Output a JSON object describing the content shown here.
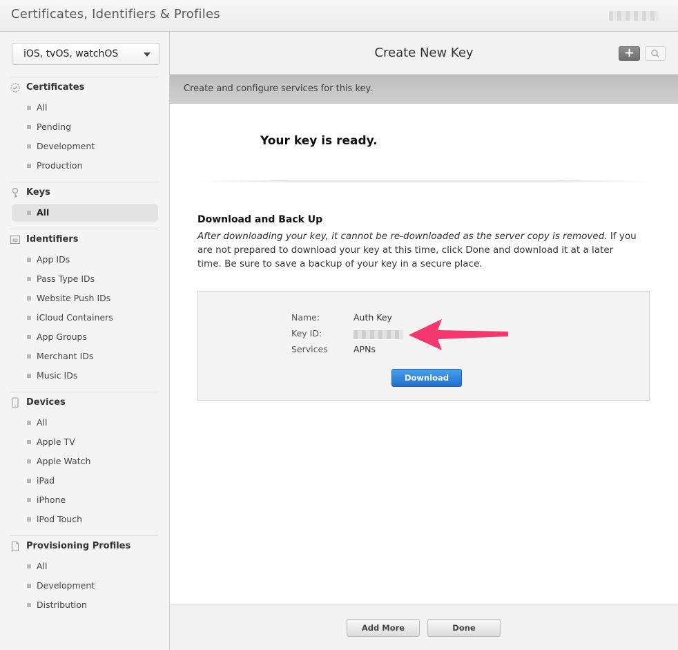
{
  "app": {
    "title": "Certificates, Identifiers & Profiles"
  },
  "platform_select": {
    "value": "iOS, tvOS, watchOS"
  },
  "sidebar": {
    "sections": [
      {
        "title": "Certificates",
        "icon": "certificate-icon",
        "items": [
          "All",
          "Pending",
          "Development",
          "Production"
        ]
      },
      {
        "title": "Keys",
        "icon": "key-icon",
        "items": [
          "All"
        ],
        "selected": "All"
      },
      {
        "title": "Identifiers",
        "icon": "id-icon",
        "items": [
          "App IDs",
          "Pass Type IDs",
          "Website Push IDs",
          "iCloud Containers",
          "App Groups",
          "Merchant IDs",
          "Music IDs"
        ]
      },
      {
        "title": "Devices",
        "icon": "device-icon",
        "items": [
          "All",
          "Apple TV",
          "Apple Watch",
          "iPad",
          "iPhone",
          "iPod Touch"
        ]
      },
      {
        "title": "Provisioning Profiles",
        "icon": "document-icon",
        "items": [
          "All",
          "Development",
          "Distribution"
        ]
      }
    ]
  },
  "main": {
    "title": "Create New Key",
    "subtitle": "Create and configure services for this key.",
    "ready_message": "Your key is ready.",
    "download_section": {
      "title": "Download and Back Up",
      "text_italic": "After downloading your key, it cannot be re-downloaded as the server copy is removed.",
      "text_normal": " If you are not prepared to download your key at this time, click Done and download it at a later time. Be sure to save a backup of your key in a secure place."
    },
    "key_details": {
      "name_label": "Name:",
      "name_value": "Auth Key",
      "keyid_label": "Key ID:",
      "services_label": "Services",
      "services_value": "APNs",
      "download_label": "Download"
    },
    "footer": {
      "add_more_label": "Add More",
      "done_label": "Done"
    }
  },
  "colors": {
    "accent_blue": "#2a7fdc",
    "annotation_arrow": "#f2386e"
  }
}
